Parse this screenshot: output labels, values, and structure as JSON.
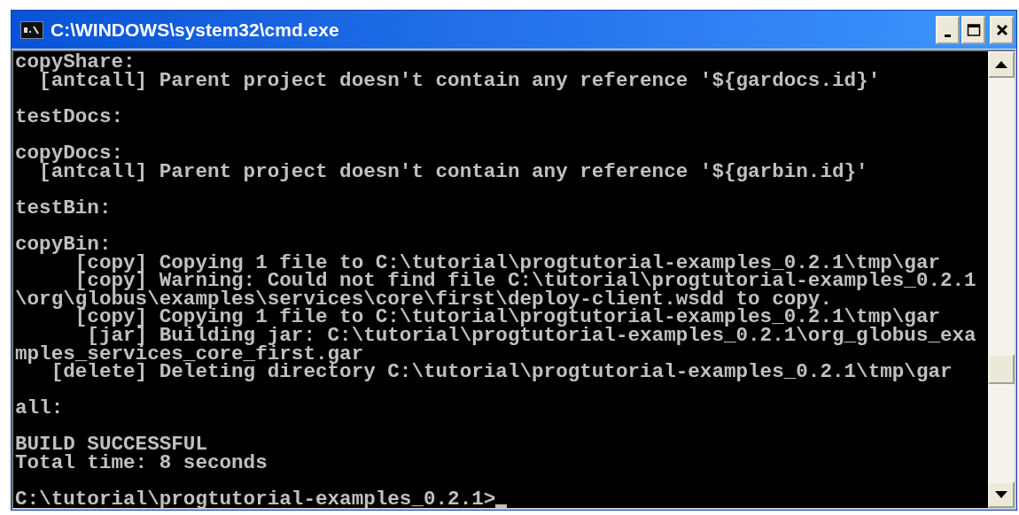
{
  "window": {
    "title": "C:\\WINDOWS\\system32\\cmd.exe"
  },
  "console": {
    "blocks": [
      [
        "copyShare:",
        "  [antcall] Parent project doesn't contain any reference '${gardocs.id}'"
      ],
      [
        "testDocs:"
      ],
      [
        "copyDocs:",
        "  [antcall] Parent project doesn't contain any reference '${garbin.id}'"
      ],
      [
        "testBin:"
      ],
      [
        "copyBin:",
        "     [copy] Copying 1 file to C:\\tutorial\\progtutorial-examples_0.2.1\\tmp\\gar",
        "     [copy] Warning: Could not find file C:\\tutorial\\progtutorial-examples_0.2.1",
        "\\org\\globus\\examples\\services\\core\\first\\deploy-client.wsdd to copy.",
        "     [copy] Copying 1 file to C:\\tutorial\\progtutorial-examples_0.2.1\\tmp\\gar",
        "      [jar] Building jar: C:\\tutorial\\progtutorial-examples_0.2.1\\org_globus_exa",
        "mples_services_core_first.gar",
        "   [delete] Deleting directory C:\\tutorial\\progtutorial-examples_0.2.1\\tmp\\gar"
      ],
      [
        "all:"
      ],
      [
        "BUILD SUCCESSFUL",
        "Total time: 8 seconds"
      ]
    ],
    "prompt": "C:\\tutorial\\progtutorial-examples_0.2.1>"
  }
}
